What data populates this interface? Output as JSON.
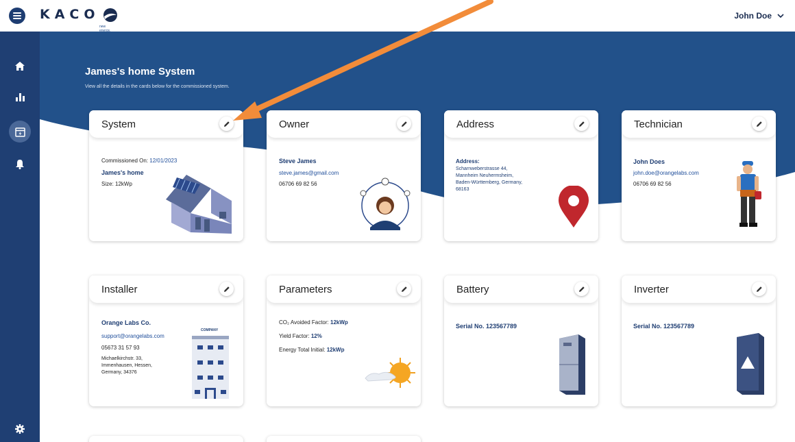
{
  "app": {
    "logo_text": "KACO",
    "logo_tagline": "new energy.",
    "user_name": "John Doe"
  },
  "hero": {
    "title": "James's home System",
    "subtitle": "View all the details in the cards below for the commissioned system."
  },
  "sidebar": {
    "items": [
      {
        "name": "home-icon"
      },
      {
        "name": "bar-chart-icon"
      },
      {
        "name": "calendar-icon",
        "active": true
      },
      {
        "name": "bell-icon"
      },
      {
        "name": "gear-icon"
      }
    ]
  },
  "cards": {
    "system": {
      "title": "System",
      "commissioned_label": "Commissioned On:",
      "commissioned_date": "12/01/2023",
      "name": "James's home",
      "size": "Size: 12kWp"
    },
    "owner": {
      "title": "Owner",
      "name": "Steve James",
      "email": "steve.james@gmail.com",
      "phone": "06706 69 82 56"
    },
    "address": {
      "title": "Address",
      "label": "Address:",
      "lines": [
        "Scharnweberstrasse 44,",
        "Mannheim Neuhermsheim,",
        "Baden-Württemberg, Germany,",
        "68163"
      ]
    },
    "technician": {
      "title": "Technician",
      "name": "John Does",
      "email": "john.doe@orangelabs.com",
      "phone": "06706 69 82 56"
    },
    "installer": {
      "title": "Installer",
      "name": "Orange Labs Co.",
      "email": "support@orangelabs.com",
      "phone": "05673 31 57 93",
      "lines": [
        "Michaelkirchstr. 33,",
        "Immenhausen, Hessen,",
        "Germany, 34376"
      ],
      "building_sign": "COMPANY"
    },
    "parameters": {
      "title": "Parameters",
      "co2_label": "CO₂ Avoided Factor:",
      "co2_value": "12kWp",
      "yield_label": "Yield Factor:",
      "yield_value": "12%",
      "energy_label": "Energy Total Initial:",
      "energy_value": "12kWp"
    },
    "battery": {
      "title": "Battery",
      "serial": "Serial No. 123567789"
    },
    "inverter": {
      "title": "Inverter",
      "serial": "Serial No. 123567789"
    }
  },
  "colors": {
    "navy": "#1f3f73",
    "hero": "#22518a",
    "link": "#1e4d9a",
    "arrow": "#f28c3a",
    "pin": "#c0272d"
  }
}
